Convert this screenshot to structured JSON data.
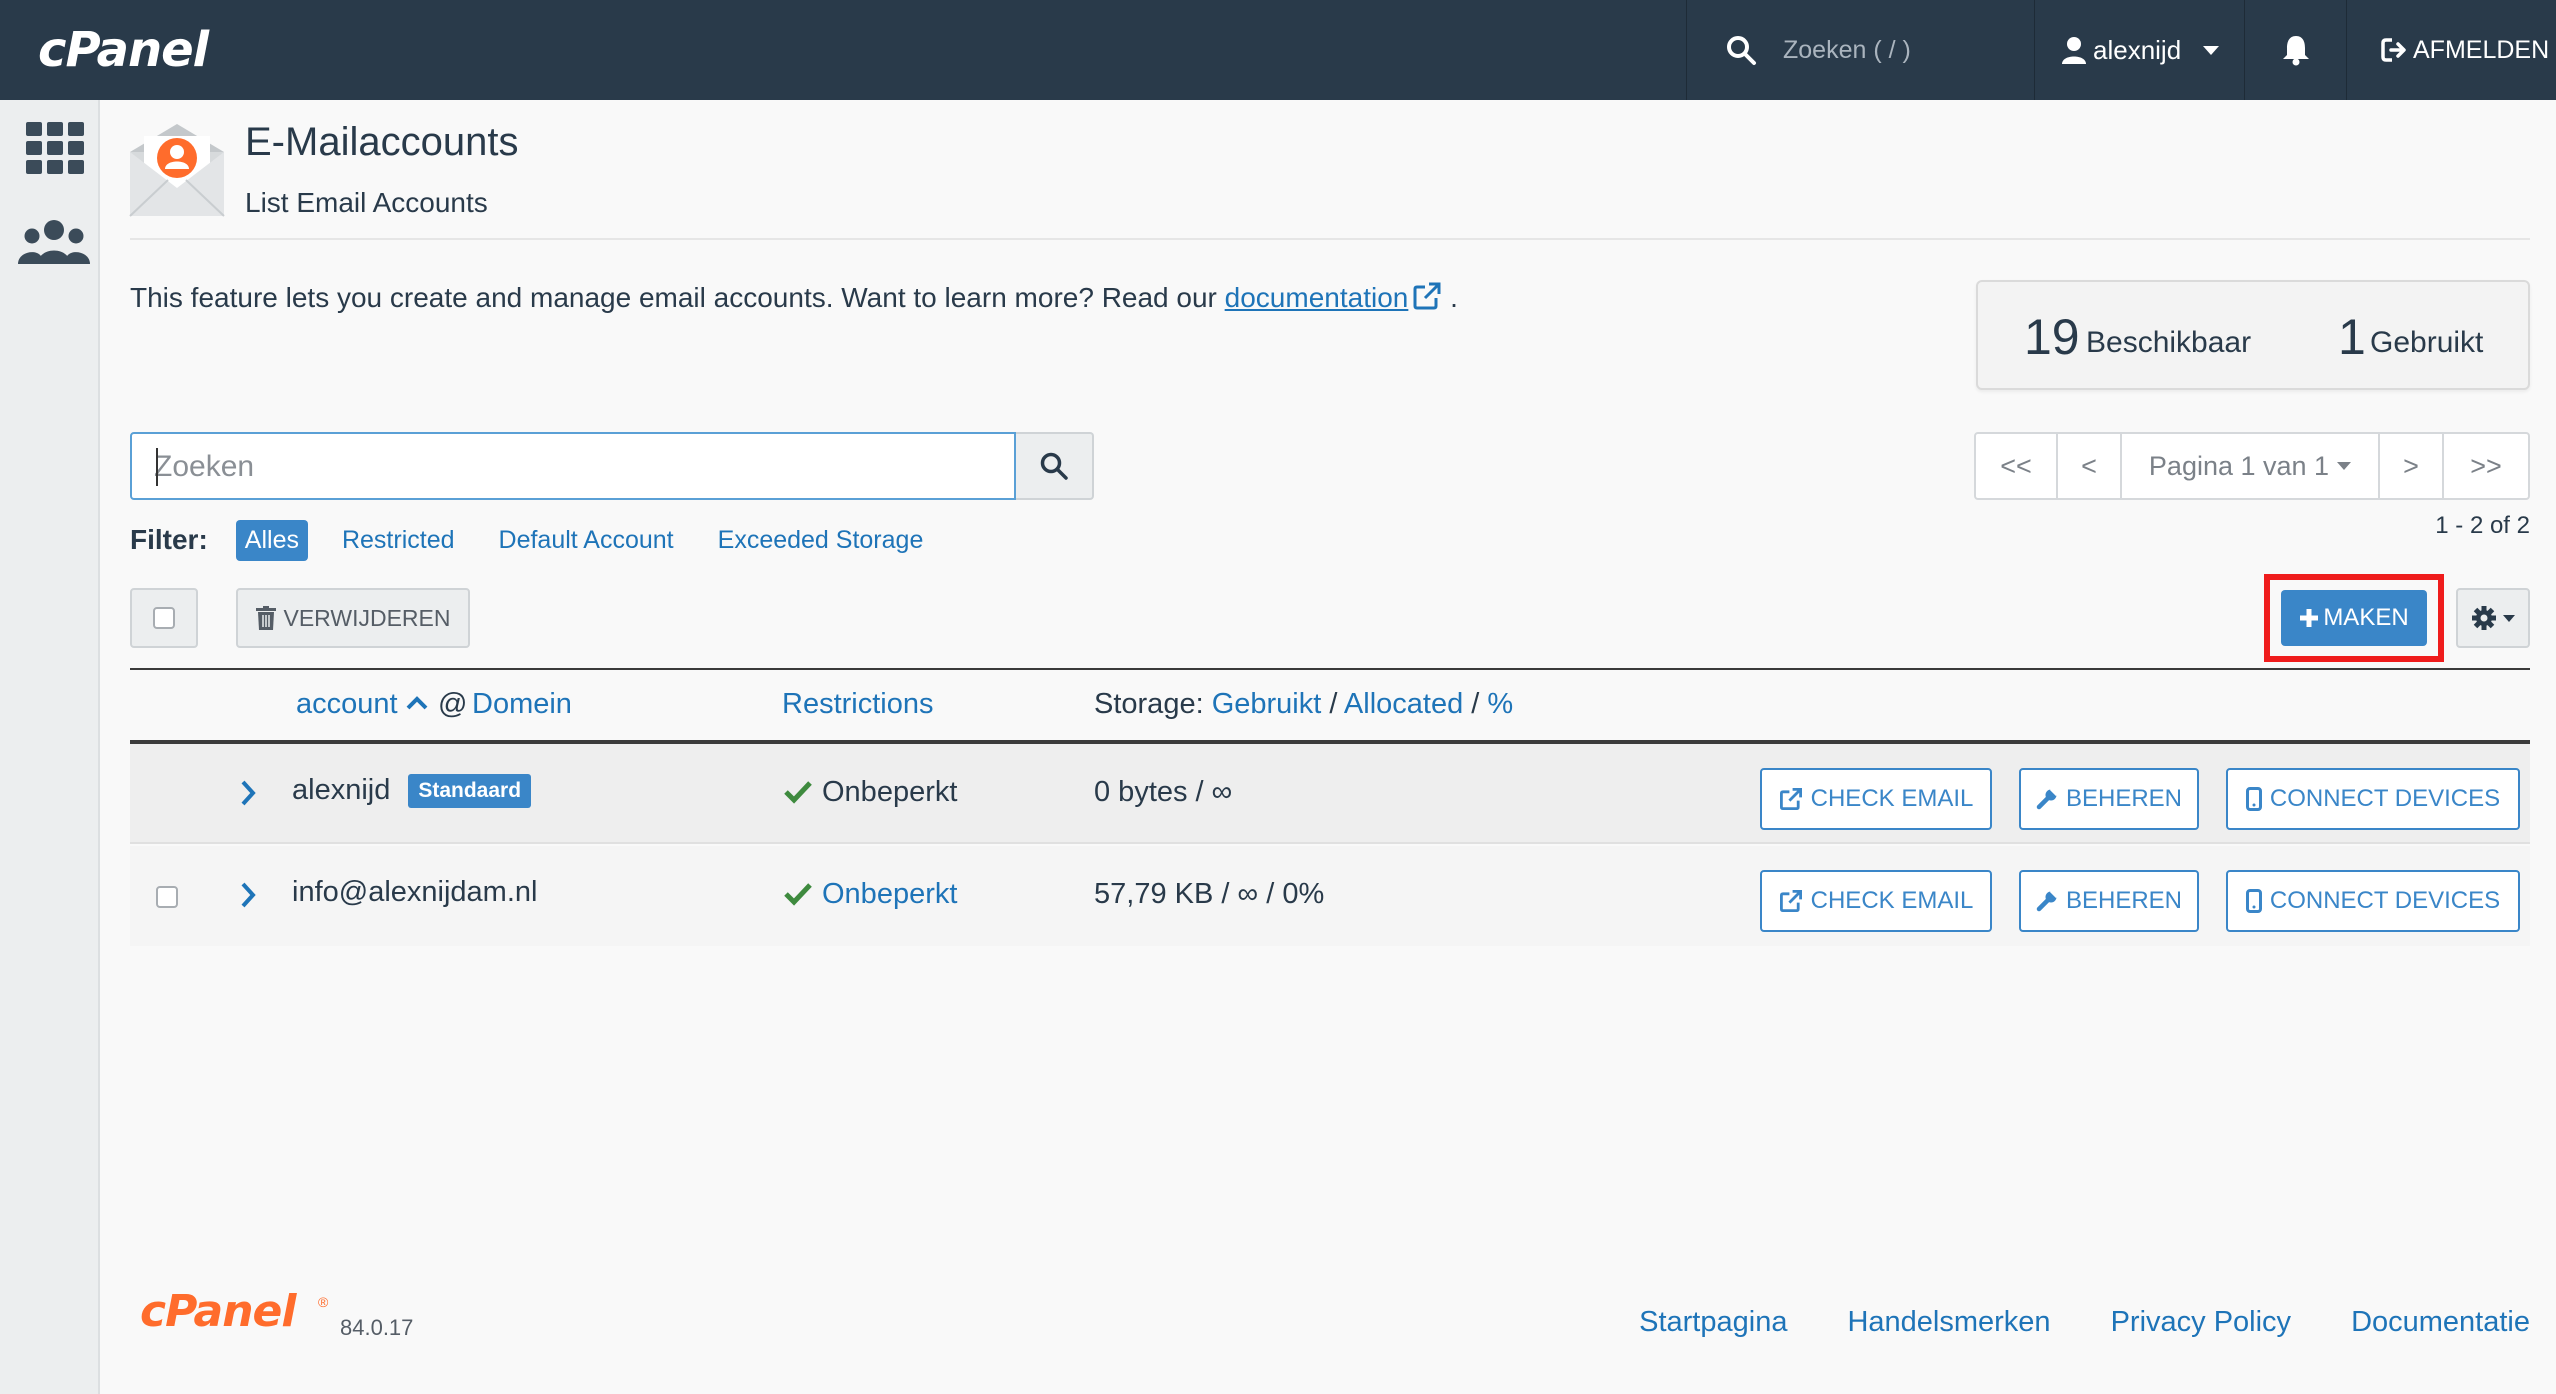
{
  "topbar": {
    "brand": "cPanel",
    "search_placeholder": "Zoeken ( / )",
    "username": "alexnijd",
    "logout_label": "AFMELDEN"
  },
  "header": {
    "title": "E-Mailaccounts",
    "subtitle": "List Email Accounts"
  },
  "intro": {
    "text": "This feature lets you create and manage email accounts. Want to learn more? Read our ",
    "link_text": "documentation",
    "suffix": "."
  },
  "stats": {
    "available_count": "19",
    "available_label": "Beschikbaar",
    "used_count": "1",
    "used_label": "Gebruikt"
  },
  "search": {
    "placeholder": "Zoeken"
  },
  "filter": {
    "label": "Filter:",
    "options": [
      "Alles",
      "Restricted",
      "Default Account",
      "Exceeded Storage"
    ],
    "active": "Alles"
  },
  "pagination": {
    "first": "<<",
    "prev": "<",
    "page_label": "Pagina 1 van 1",
    "next": ">",
    "last": ">>",
    "range": "1 - 2 of 2"
  },
  "actions": {
    "delete_label": "VERWIJDEREN",
    "create_label": "MAKEN"
  },
  "table": {
    "col_account": "account",
    "col_at": "@",
    "col_domain": "Domein",
    "col_restrictions": "Restrictions",
    "col_storage_prefix": "Storage:",
    "col_storage_used": "Gebruikt",
    "col_storage_sep1": "/",
    "col_storage_alloc": "Allocated",
    "col_storage_sep2": "/",
    "col_storage_pct": "%",
    "rows": [
      {
        "account": "alexnijd",
        "badge": "Standaard",
        "restriction": "Onbeperkt",
        "storage": "0 bytes / ∞",
        "btn_check": "CHECK EMAIL",
        "btn_manage": "BEHEREN",
        "btn_connect": "CONNECT DEVICES"
      },
      {
        "account": "info@alexnijdam.nl",
        "restriction": "Onbeperkt",
        "storage": "57,79 KB / ∞ / 0%",
        "btn_check": "CHECK EMAIL",
        "btn_manage": "BEHEREN",
        "btn_connect": "CONNECT DEVICES"
      }
    ]
  },
  "footer": {
    "brand": "cPanel",
    "registered": "®",
    "version": "84.0.17",
    "links": [
      "Startpagina",
      "Handelsmerken",
      "Privacy Policy",
      "Documentatie"
    ]
  },
  "colors": {
    "topbar": "#293a4a",
    "primary": "#3a86c8",
    "link": "#1e74b8",
    "highlight_frame": "#ef1c1c",
    "success": "#3e8a3e",
    "brand_orange": "#ff6c2c"
  }
}
